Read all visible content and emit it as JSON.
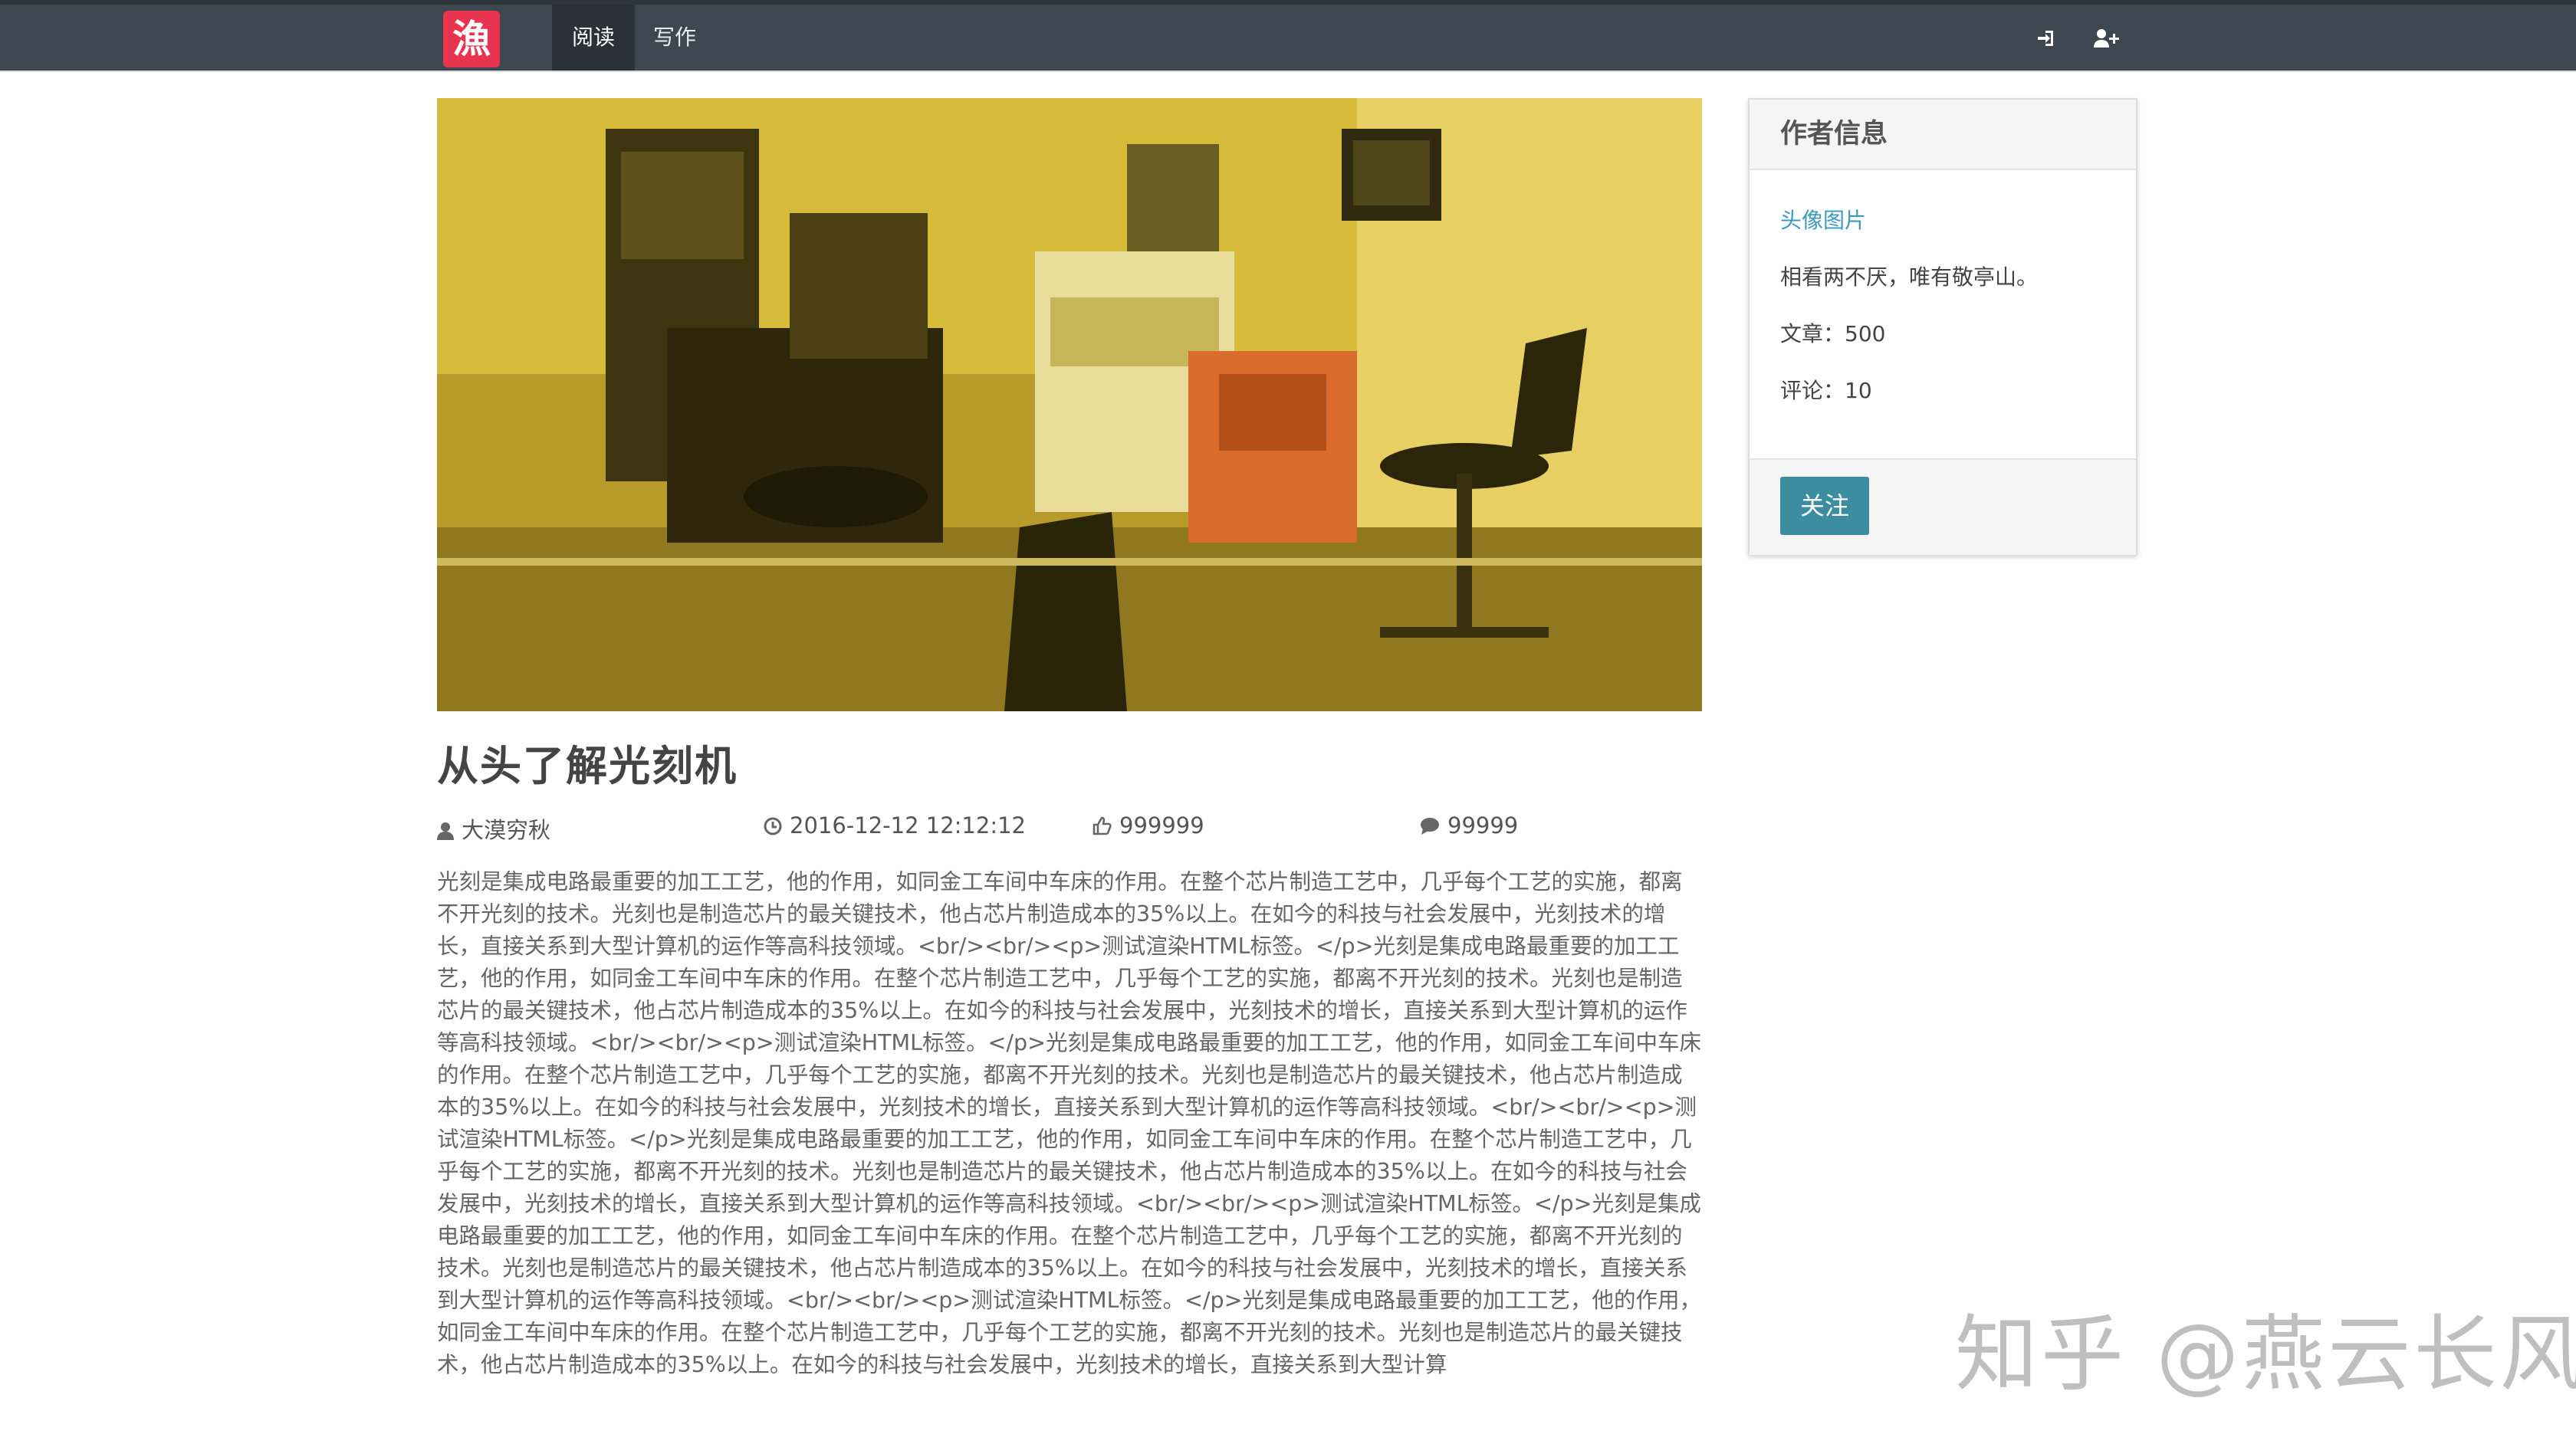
{
  "navbar": {
    "logo": "漁",
    "items": [
      {
        "label": "阅读",
        "active": true
      },
      {
        "label": "写作",
        "active": false
      }
    ],
    "icons": [
      "sign-in-icon",
      "user-plus-icon"
    ],
    "bg_color": "#3e4650"
  },
  "hero": {
    "description_icon": "lab-equipment-photo"
  },
  "article": {
    "title": "从头了解光刻机",
    "author": "大漠穷秋",
    "date": "2016-12-12 12:12:12",
    "likes": "999999",
    "comments": "99999",
    "body": "光刻是集成电路最重要的加工工艺，他的作用，如同金工车间中车床的作用。在整个芯片制造工艺中，几乎每个工艺的实施，都离不开光刻的技术。光刻也是制造芯片的最关键技术，他占芯片制造成本的35%以上。在如今的科技与社会发展中，光刻技术的增长，直接关系到大型计算机的运作等高科技领域。<br/><br/><p>测试渲染HTML标签。</p>光刻是集成电路最重要的加工工艺，他的作用，如同金工车间中车床的作用。在整个芯片制造工艺中，几乎每个工艺的实施，都离不开光刻的技术。光刻也是制造芯片的最关键技术，他占芯片制造成本的35%以上。在如今的科技与社会发展中，光刻技术的增长，直接关系到大型计算机的运作等高科技领域。<br/><br/><p>测试渲染HTML标签。</p>光刻是集成电路最重要的加工工艺，他的作用，如同金工车间中车床的作用。在整个芯片制造工艺中，几乎每个工艺的实施，都离不开光刻的技术。光刻也是制造芯片的最关键技术，他占芯片制造成本的35%以上。在如今的科技与社会发展中，光刻技术的增长，直接关系到大型计算机的运作等高科技领域。<br/><br/><p>测试渲染HTML标签。</p>光刻是集成电路最重要的加工工艺，他的作用，如同金工车间中车床的作用。在整个芯片制造工艺中，几乎每个工艺的实施，都离不开光刻的技术。光刻也是制造芯片的最关键技术，他占芯片制造成本的35%以上。在如今的科技与社会发展中，光刻技术的增长，直接关系到大型计算机的运作等高科技领域。<br/><br/><p>测试渲染HTML标签。</p>光刻是集成电路最重要的加工工艺，他的作用，如同金工车间中车床的作用。在整个芯片制造工艺中，几乎每个工艺的实施，都离不开光刻的技术。光刻也是制造芯片的最关键技术，他占芯片制造成本的35%以上。在如今的科技与社会发展中，光刻技术的增长，直接关系到大型计算机的运作等高科技领域。<br/><br/><p>测试渲染HTML标签。</p>光刻是集成电路最重要的加工工艺，他的作用，如同金工车间中车床的作用。在整个芯片制造工艺中，几乎每个工艺的实施，都离不开光刻的技术。光刻也是制造芯片的最关键技术，他占芯片制造成本的35%以上。在如今的科技与社会发展中，光刻技术的增长，直接关系到大型计算"
  },
  "author_card": {
    "header": "作者信息",
    "avatar_link": "头像图片",
    "motto": "相看两不厌，唯有敬亭山。",
    "articles": "文章：500",
    "comments": "评论：10",
    "follow_label": "关注",
    "accent_color": "#3c8d9f"
  },
  "watermark": "知乎 @燕云长风"
}
